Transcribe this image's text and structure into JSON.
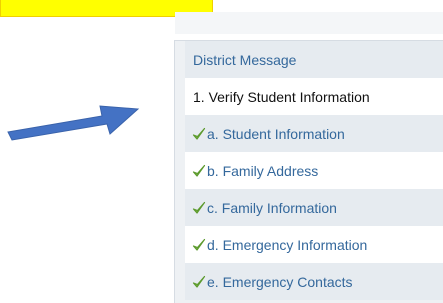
{
  "colors": {
    "highlight": "#ffff00",
    "arrow": "#4472c4",
    "link_text": "#34689c",
    "current_text": "#111111",
    "check": "#7cb342"
  },
  "icons": {
    "arrow": "arrow-right-icon",
    "step_complete": "checkmark-icon"
  },
  "menu": {
    "items": [
      {
        "label": "District Message",
        "state": "link"
      },
      {
        "label": "1. Verify Student Information",
        "state": "current"
      },
      {
        "label": "a. Student Information",
        "state": "complete"
      },
      {
        "label": "b. Family Address",
        "state": "complete"
      },
      {
        "label": "c. Family Information",
        "state": "complete"
      },
      {
        "label": "d. Emergency Information",
        "state": "complete"
      },
      {
        "label": "e. Emergency Contacts",
        "state": "complete"
      }
    ]
  }
}
